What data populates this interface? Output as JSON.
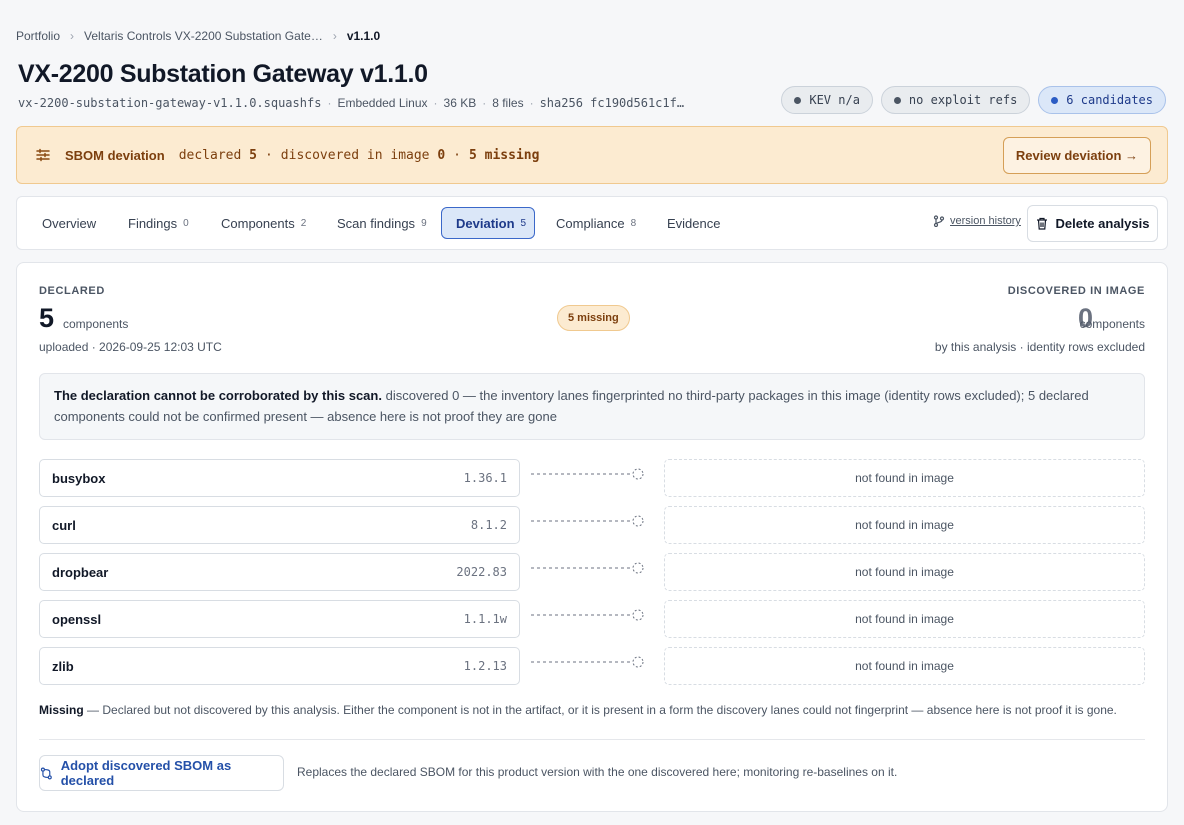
{
  "breadcrumb": {
    "root": "Portfolio",
    "product": "Veltaris Controls VX-2200 Substation Gate…",
    "version": "v1.1.0"
  },
  "header": {
    "title": "VX-2200 Substation Gateway v1.1.0",
    "filename": "vx-2200-substation-gateway-v1.1.0.squashfs",
    "os": "Embedded Linux",
    "size": "36 KB",
    "files": "8 files",
    "hash": "sha256 fc190d561c1f…"
  },
  "badges": {
    "kev": "KEV n/a",
    "exploit": "no exploit refs",
    "candidates": "6 candidates"
  },
  "banner": {
    "title": "SBOM deviation",
    "declared_label": "declared",
    "declared_value": "5",
    "discovered_label": "discovered in image",
    "discovered_value": "0",
    "missing": "5 missing",
    "review_button": "Review deviation →"
  },
  "tabs": [
    {
      "label": "Overview",
      "count": ""
    },
    {
      "label": "Findings",
      "count": "0"
    },
    {
      "label": "Components",
      "count": "2"
    },
    {
      "label": "Scan findings",
      "count": "9"
    },
    {
      "label": "Deviation",
      "count": "5"
    },
    {
      "label": "Compliance",
      "count": "8"
    },
    {
      "label": "Evidence",
      "count": ""
    }
  ],
  "toolbar": {
    "version_history": "version history",
    "delete_button": "Delete analysis"
  },
  "declared": {
    "label": "DECLARED",
    "count": "5",
    "unit": "components",
    "sub": "uploaded · 2026-09-25 12:03 UTC"
  },
  "missing_pill": "5 missing",
  "discovered": {
    "label": "DISCOVERED IN IMAGE",
    "count": "0",
    "unit": "components",
    "sub": "by this analysis · identity rows excluded"
  },
  "notice": {
    "bold": "The declaration cannot be corroborated by this scan.",
    "text": "discovered 0 — the inventory lanes fingerprinted no third-party packages in this image (identity rows excluded); 5 declared components could not be confirmed present — absence here is not proof they are gone"
  },
  "components": [
    {
      "name": "busybox",
      "version": "1.36.1",
      "status": "not found in image"
    },
    {
      "name": "curl",
      "version": "8.1.2",
      "status": "not found in image"
    },
    {
      "name": "dropbear",
      "version": "2022.83",
      "status": "not found in image"
    },
    {
      "name": "openssl",
      "version": "1.1.1w",
      "status": "not found in image"
    },
    {
      "name": "zlib",
      "version": "1.2.13",
      "status": "not found in image"
    }
  ],
  "legend": {
    "term": "Missing",
    "text": "— Declared but not discovered by this analysis. Either the component is not in the artifact, or it is present in a form the discovery lanes could not fingerprint — absence here is not proof it is gone."
  },
  "adopt": {
    "button": "Adopt discovered SBOM as declared",
    "note": "Replaces the declared SBOM for this product version with the one discovered here; monitoring re-baselines on it."
  }
}
